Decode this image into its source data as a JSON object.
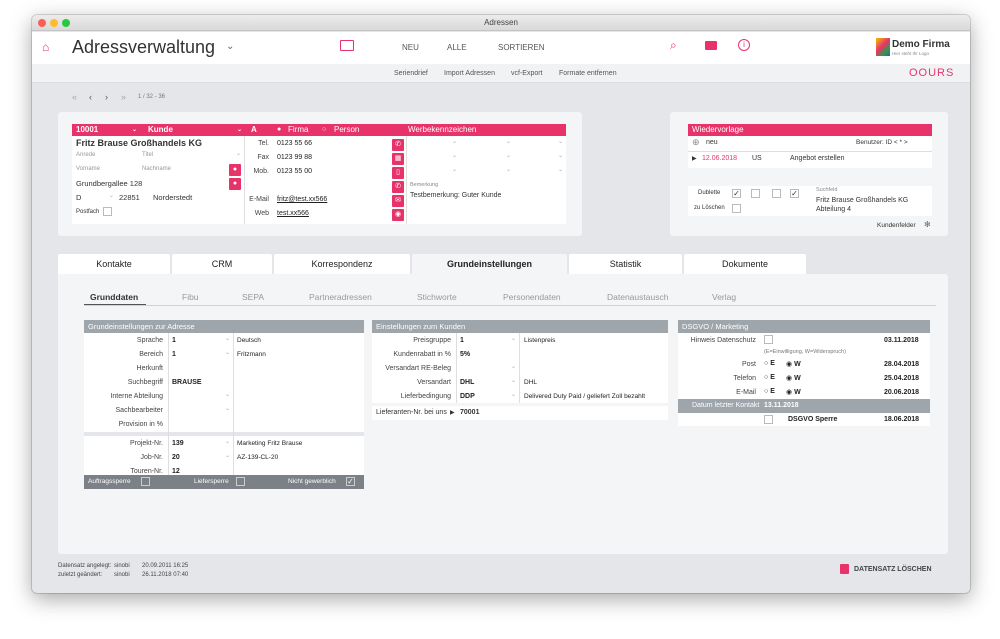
{
  "window": {
    "title": "Adressen"
  },
  "toolbar": {
    "title": "Adressverwaltung",
    "nav": [
      "NEU",
      "ALLE",
      "SORTIEREN"
    ],
    "brand_name": "Demo Firma",
    "brand_tagline": "Hier steht Ihr Logo"
  },
  "subbar": {
    "links": [
      "Seriendrief",
      "Import Adressen",
      "vcf-Export",
      "Formate entfernen"
    ],
    "brand": "OOURS"
  },
  "record_nav": {
    "position": "1 / 32 - 36"
  },
  "address": {
    "id": "10001",
    "type": "Kunde",
    "ab": "A",
    "opt_firma": "Firma",
    "opt_person": "Person",
    "werbe_label": "Werbekennzeichen",
    "company": "Fritz Brause Großhandels KG",
    "anrede_ph": "Anrede",
    "titel_ph": "Titel",
    "vorname_ph": "Vorname",
    "nachname_ph": "Nachname",
    "street": "Grundbergallee 128",
    "country": "D",
    "zip": "22851",
    "city": "Norderstedt",
    "postfach_label": "Postfach",
    "tel_label": "Tel.",
    "tel": "0123 55 66",
    "fax_label": "Fax",
    "fax": "0123 99 88",
    "mob_label": "Mob.",
    "mob": "0123 55 00",
    "email_label": "E-Mail",
    "email": "fritz@test.xx566",
    "web_label": "Web",
    "web": "test.xx566",
    "bemerkung_label": "Bemerkung",
    "bemerkung": "Testbemerkung: Guter Kunde"
  },
  "wiedervorlage": {
    "title": "Wiedervorlage",
    "new_label": "neu",
    "benutzer": "Benutzer: ID  < * >",
    "date": "12.06.2018",
    "user": "US",
    "task": "Angebot erstellen",
    "dublette": "Dublette",
    "zu_loeschen": "zu Löschen",
    "suchfeld_label": "Suchfeld",
    "suchfeld": "Fritz Brause Großhandels KG",
    "suchfeld2": "Abteilung 4",
    "kundenfelder": "Kundenfelder"
  },
  "tabs": [
    "Kontakte",
    "CRM",
    "Korrespondenz",
    "Grundeinstellungen",
    "Statistik",
    "Dokumente"
  ],
  "subtabs": [
    "Grunddaten",
    "Fibu",
    "SEPA",
    "Partneradressen",
    "Stichworte",
    "Personendaten",
    "Datenaustausch",
    "Verlag"
  ],
  "grund": {
    "title": "Grundeinstellungen zur Adresse",
    "sprache_l": "Sprache",
    "sprache": "1",
    "sprache_t": "Deutsch",
    "bereich_l": "Bereich",
    "bereich": "1",
    "bereich_t": "Fritzmann",
    "herkunft_l": "Herkunft",
    "suchbegriff_l": "Suchbegriff",
    "suchbegriff": "BRAUSE",
    "abteilung_l": "Interne Abteilung",
    "sachbearbeiter_l": "Sachbearbeiter",
    "provision_l": "Provision in %",
    "projekt_l": "Projekt-Nr.",
    "projekt": "139",
    "projekt_t": "Marketing Fritz Brause",
    "job_l": "Job-Nr.",
    "job": "20",
    "job_t": "AZ-139-CL-20",
    "touren_l": "Touren-Nr.",
    "touren": "12",
    "auftragssperre": "Auftragssperre",
    "liefersperre": "Liefersperre",
    "nicht_gewerblich": "Nicht gewerblich"
  },
  "kunde": {
    "title": "Einstellungen zum Kunden",
    "preisgruppe_l": "Preisgruppe",
    "preisgruppe": "1",
    "preisgruppe_t": "Listenpreis",
    "rabatt_l": "Kundenrabatt in %",
    "rabatt": "5%",
    "versandart_re_l": "Versandart RE-Beleg",
    "versandart_l": "Versandart",
    "versandart": "DHL",
    "versandart_t": "DHL",
    "lieferbed_l": "Lieferbedingung",
    "lieferbed": "DDP",
    "lieferbed_t": "Delivered Duty Paid / geliefert Zoll bezahlt",
    "lieferanten_l": "Lieferanten-Nr. bei uns",
    "lieferanten": "70001"
  },
  "dsgvo": {
    "title": "DSGVO / Marketing",
    "hinweis_l": "Hinweis Datenschutz",
    "hinweis_d": "03.11.2018",
    "legend": "(E=Einwilligung, W=Widerspruch)",
    "post_l": "Post",
    "post_d": "28.04.2018",
    "telefon_l": "Telefon",
    "telefon_d": "25.04.2018",
    "email_l": "E-Mail",
    "email_d": "20.06.2018",
    "e": "E",
    "w": "W",
    "kontakt_l": "Datum letzter Kontakt",
    "kontakt_d": "13.11.2018",
    "sperre_l": "DSGVO Sperre",
    "sperre_d": "18.06.2018"
  },
  "footer": {
    "angelegt_l": "Datensatz angelegt:",
    "angelegt_u": "sinobi",
    "angelegt_d": "20.09.2011 16:25",
    "geaendert_l": "zuletzt geändert:",
    "geaendert_u": "sinobi",
    "geaendert_d": "26.11.2018 07:40",
    "delete": "DATENSATZ LÖSCHEN"
  },
  "colors": {
    "accent": "#e8336a",
    "group_header": "#9ea5ab"
  }
}
